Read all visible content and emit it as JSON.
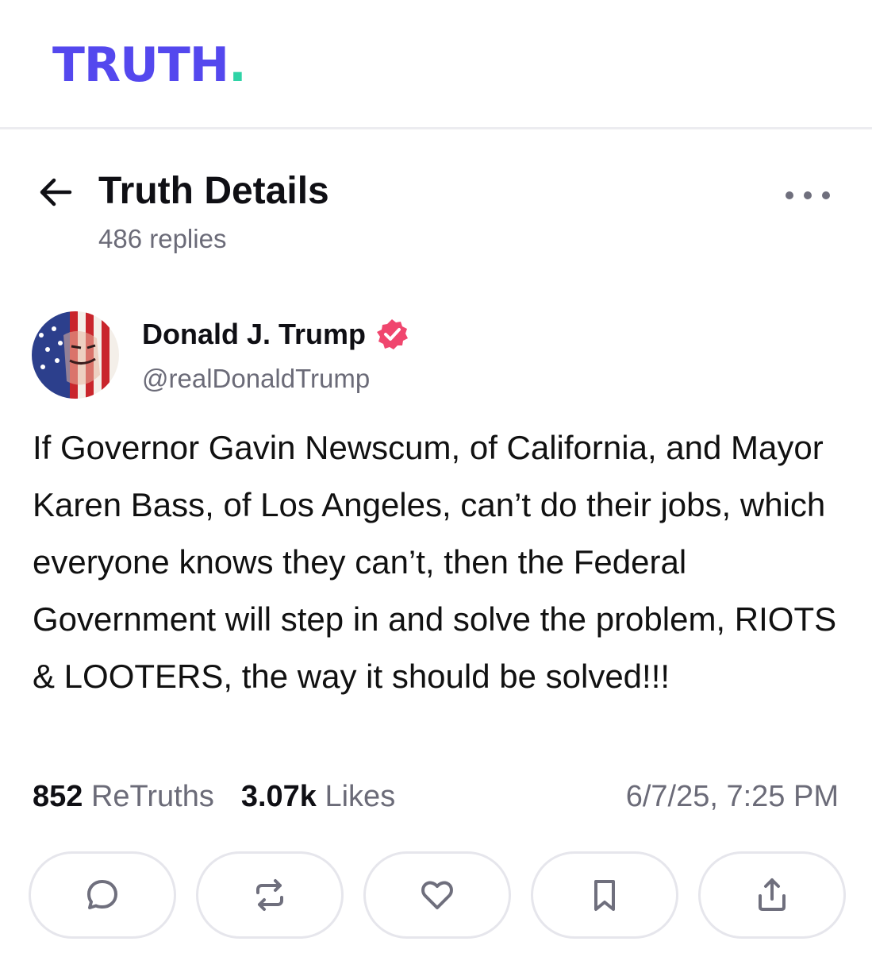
{
  "brand": {
    "logo_text": "TRUTH",
    "logo_dot": ".",
    "accent": "#5448ee",
    "dot_color": "#2fd3a6"
  },
  "header": {
    "title": "Truth Details",
    "replies": "486 replies",
    "back_icon": "arrow-left-icon",
    "more_icon": "more-horizontal-icon"
  },
  "post": {
    "author_name": "Donald J. Trump",
    "author_handle": "@realDonaldTrump",
    "verified_color": "#f0466e",
    "text": "If Governor Gavin Newscum, of California, and Mayor Karen Bass, of Los Angeles, can’t do their jobs, which everyone knows they can’t, then the Federal Government will step in and solve the problem, RIOTS & LOOTERS, the way it should be solved!!!",
    "retruths_count": "852",
    "retruths_label": "ReTruths",
    "likes_count": "3.07k",
    "likes_label": "Likes",
    "timestamp": "6/7/25, 7:25 PM"
  },
  "actions": [
    {
      "icon": "comment-icon"
    },
    {
      "icon": "retruth-icon"
    },
    {
      "icon": "heart-icon"
    },
    {
      "icon": "bookmark-icon"
    },
    {
      "icon": "share-icon"
    }
  ]
}
